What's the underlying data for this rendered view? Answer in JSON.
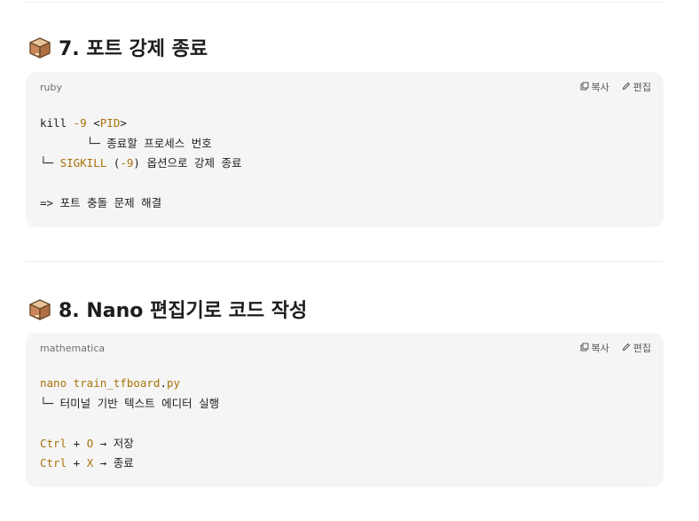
{
  "sections": [
    {
      "heading": "7. 포트 강제 종료",
      "language": "ruby",
      "copy_label": "복사",
      "edit_label": "편집",
      "lines": [
        [
          {
            "t": "kill ",
            "c": "plain"
          },
          {
            "t": "-9",
            "c": "kw"
          },
          {
            "t": " <",
            "c": "plain"
          },
          {
            "t": "PID",
            "c": "kw"
          },
          {
            "t": ">",
            "c": "plain"
          }
        ],
        [
          {
            "t": "       └─ 종료할 프로세스 번호",
            "c": "plain"
          }
        ],
        [
          {
            "t": "└─ ",
            "c": "plain"
          },
          {
            "t": "SIGKILL",
            "c": "kw"
          },
          {
            "t": " (",
            "c": "plain"
          },
          {
            "t": "-9",
            "c": "kw"
          },
          {
            "t": ") 옵션으로 강제 종료",
            "c": "plain"
          }
        ],
        [],
        [
          {
            "t": "=> 포트 충돌 문제 해결",
            "c": "plain"
          }
        ]
      ]
    },
    {
      "heading": "8. Nano 편집기로 코드 작성",
      "language": "mathematica",
      "copy_label": "복사",
      "edit_label": "편집",
      "lines": [
        [
          {
            "t": "nano train_tfboard",
            "c": "kw"
          },
          {
            "t": ".",
            "c": "plain"
          },
          {
            "t": "py",
            "c": "kw"
          }
        ],
        [
          {
            "t": "└─ 터미널 기반 텍스트 에디터 실행",
            "c": "plain"
          }
        ],
        [],
        [
          {
            "t": "Ctrl",
            "c": "kw"
          },
          {
            "t": " + ",
            "c": "plain"
          },
          {
            "t": "O",
            "c": "kw"
          },
          {
            "t": " → 저장",
            "c": "plain"
          }
        ],
        [
          {
            "t": "Ctrl",
            "c": "kw"
          },
          {
            "t": " + ",
            "c": "plain"
          },
          {
            "t": "X",
            "c": "kw"
          },
          {
            "t": " → 종료",
            "c": "plain"
          }
        ]
      ]
    }
  ],
  "icons": {
    "section_icon": "package-box-icon",
    "copy_icon": "copy-icon",
    "edit_icon": "pencil-icon"
  },
  "colors": {
    "code_keyword": "#a9720a",
    "code_text": "#1f1f1f",
    "card_background": "#f5f5f5"
  }
}
